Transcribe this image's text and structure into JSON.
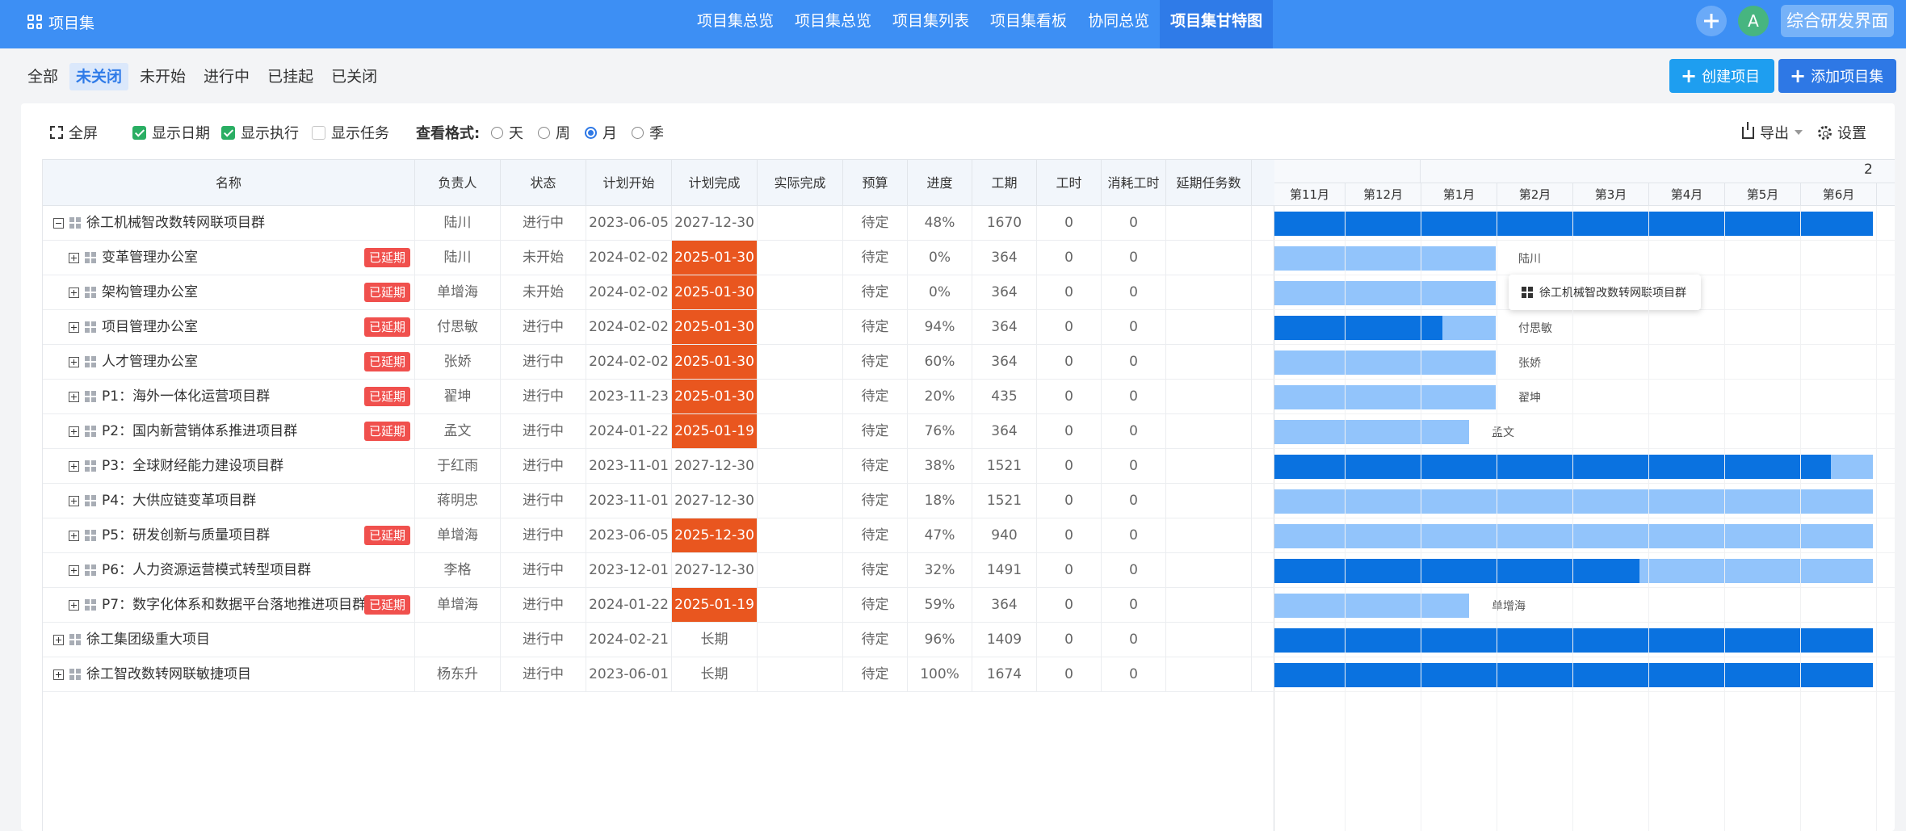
{
  "topbar": {
    "brand": "项目集",
    "nav": [
      "项目集总览",
      "项目集总览",
      "项目集列表",
      "项目集看板",
      "协同总览",
      "项目集甘特图"
    ],
    "active_index": 5,
    "avatar": "A",
    "switch_label": "综合研发界面"
  },
  "filters": {
    "items": [
      "全部",
      "未关闭",
      "未开始",
      "进行中",
      "已挂起",
      "已关闭"
    ],
    "active_index": 1
  },
  "actions": {
    "create": "创建项目",
    "add_set": "添加项目集"
  },
  "toolbar": {
    "fullscreen": "全屏",
    "show_date": "显示日期",
    "show_exec": "显示执行",
    "show_task": "显示任务",
    "view_format": "查看格式:",
    "day": "天",
    "week": "周",
    "month": "月",
    "season": "季",
    "selected_view": "月",
    "export": "导出",
    "settings": "设置"
  },
  "table": {
    "columns": [
      "名称",
      "负责人",
      "状态",
      "计划开始",
      "计划完成",
      "实际完成",
      "预算",
      "进度",
      "工期",
      "工时",
      "消耗工时",
      "延期任务数"
    ],
    "overdue_label": "已延期",
    "rows": [
      {
        "name": "徐工机械智改数转网联项目群",
        "level": 0,
        "expanded": true,
        "owner": "陆川",
        "status": "进行中",
        "start": "2023-06-05",
        "end": "2027-12-30",
        "overdue": false,
        "actual": "",
        "budget": "待定",
        "progress": "48%",
        "duration": "1670",
        "hours": "0",
        "consumed": "0",
        "delayed": ""
      },
      {
        "name": "变革管理办公室",
        "level": 1,
        "expanded": false,
        "owner": "陆川",
        "status": "未开始",
        "start": "2024-02-02",
        "end": "2025-01-30",
        "overdue": true,
        "actual": "",
        "budget": "待定",
        "progress": "0%",
        "duration": "364",
        "hours": "0",
        "consumed": "0",
        "delayed": ""
      },
      {
        "name": "架构管理办公室",
        "level": 1,
        "expanded": false,
        "owner": "单增海",
        "status": "未开始",
        "start": "2024-02-02",
        "end": "2025-01-30",
        "overdue": true,
        "actual": "",
        "budget": "待定",
        "progress": "0%",
        "duration": "364",
        "hours": "0",
        "consumed": "0",
        "delayed": ""
      },
      {
        "name": "项目管理办公室",
        "level": 1,
        "expanded": false,
        "owner": "付思敏",
        "status": "进行中",
        "start": "2024-02-02",
        "end": "2025-01-30",
        "overdue": true,
        "actual": "",
        "budget": "待定",
        "progress": "94%",
        "duration": "364",
        "hours": "0",
        "consumed": "0",
        "delayed": ""
      },
      {
        "name": "人才管理办公室",
        "level": 1,
        "expanded": false,
        "owner": "张娇",
        "status": "进行中",
        "start": "2024-02-02",
        "end": "2025-01-30",
        "overdue": true,
        "actual": "",
        "budget": "待定",
        "progress": "60%",
        "duration": "364",
        "hours": "0",
        "consumed": "0",
        "delayed": ""
      },
      {
        "name": "P1：海外一体化运营项目群",
        "level": 1,
        "expanded": false,
        "owner": "翟坤",
        "status": "进行中",
        "start": "2023-11-23",
        "end": "2025-01-30",
        "overdue": true,
        "actual": "",
        "budget": "待定",
        "progress": "20%",
        "duration": "435",
        "hours": "0",
        "consumed": "0",
        "delayed": ""
      },
      {
        "name": "P2：国内新营销体系推进项目群",
        "level": 1,
        "expanded": false,
        "owner": "孟文",
        "status": "进行中",
        "start": "2024-01-22",
        "end": "2025-01-19",
        "overdue": true,
        "actual": "",
        "budget": "待定",
        "progress": "76%",
        "duration": "364",
        "hours": "0",
        "consumed": "0",
        "delayed": ""
      },
      {
        "name": "P3：全球财经能力建设项目群",
        "level": 1,
        "expanded": false,
        "owner": "于红雨",
        "status": "进行中",
        "start": "2023-11-01",
        "end": "2027-12-30",
        "overdue": false,
        "actual": "",
        "budget": "待定",
        "progress": "38%",
        "duration": "1521",
        "hours": "0",
        "consumed": "0",
        "delayed": ""
      },
      {
        "name": "P4：大供应链变革项目群",
        "level": 1,
        "expanded": false,
        "owner": "蒋明忠",
        "status": "进行中",
        "start": "2023-11-01",
        "end": "2027-12-30",
        "overdue": false,
        "actual": "",
        "budget": "待定",
        "progress": "18%",
        "duration": "1521",
        "hours": "0",
        "consumed": "0",
        "delayed": ""
      },
      {
        "name": "P5：研发创新与质量项目群",
        "level": 1,
        "expanded": false,
        "owner": "单增海",
        "status": "进行中",
        "start": "2023-06-05",
        "end": "2025-12-30",
        "overdue": true,
        "actual": "",
        "budget": "待定",
        "progress": "47%",
        "duration": "940",
        "hours": "0",
        "consumed": "0",
        "delayed": ""
      },
      {
        "name": "P6：人力资源运营模式转型项目群",
        "level": 1,
        "expanded": false,
        "owner": "李格",
        "status": "进行中",
        "start": "2023-12-01",
        "end": "2027-12-30",
        "overdue": false,
        "actual": "",
        "budget": "待定",
        "progress": "32%",
        "duration": "1491",
        "hours": "0",
        "consumed": "0",
        "delayed": ""
      },
      {
        "name": "P7：数字化体系和数据平台落地推进项目群",
        "level": 1,
        "expanded": false,
        "owner": "单增海",
        "status": "进行中",
        "start": "2024-01-22",
        "end": "2025-01-19",
        "overdue": true,
        "actual": "",
        "budget": "待定",
        "progress": "59%",
        "duration": "364",
        "hours": "0",
        "consumed": "0",
        "delayed": ""
      },
      {
        "name": "徐工集团级重大项目",
        "level": 0,
        "expanded": false,
        "owner": "",
        "status": "进行中",
        "start": "2024-02-21",
        "end": "长期",
        "overdue": false,
        "actual": "",
        "budget": "待定",
        "progress": "96%",
        "duration": "1409",
        "hours": "0",
        "consumed": "0",
        "delayed": ""
      },
      {
        "name": "徐工智改数转网联敏捷项目",
        "level": 0,
        "expanded": false,
        "owner": "杨东升",
        "status": "进行中",
        "start": "2023-06-01",
        "end": "长期",
        "overdue": false,
        "actual": "",
        "budget": "待定",
        "progress": "100%",
        "duration": "1674",
        "hours": "0",
        "consumed": "0",
        "delayed": ""
      }
    ]
  },
  "gantt": {
    "year_label": "2",
    "months": [
      "第11月",
      "第12月",
      "第1月",
      "第2月",
      "第3月",
      "第4月",
      "第5月",
      "第6月"
    ],
    "bars": [
      {
        "label": "",
        "progress": 1.0,
        "extent": 1.0
      },
      {
        "label": "陆川",
        "progress": 0.0,
        "extent": 0.37
      },
      {
        "label": "单增海",
        "progress": 0.0,
        "extent": 0.37
      },
      {
        "label": "付思敏",
        "progress": 0.76,
        "extent": 0.37
      },
      {
        "label": "张娇",
        "progress": 0.0,
        "extent": 0.37
      },
      {
        "label": "翟坤",
        "progress": 0.0,
        "extent": 0.37
      },
      {
        "label": "孟文",
        "progress": 0.0,
        "extent": 0.325
      },
      {
        "label": "",
        "progress": 0.93,
        "extent": 1.0
      },
      {
        "label": "",
        "progress": 0.0,
        "extent": 1.0
      },
      {
        "label": "",
        "progress": 0.0,
        "extent": 1.0
      },
      {
        "label": "",
        "progress": 0.61,
        "extent": 1.0
      },
      {
        "label": "单增海",
        "progress": 0.0,
        "extent": 0.325
      },
      {
        "label": "",
        "progress": 1.0,
        "extent": 1.0
      },
      {
        "label": "",
        "progress": 1.0,
        "extent": 1.0
      }
    ],
    "tooltip": "徐工机械智改数转网联项目群"
  },
  "colors": {
    "primary": "#3d8ff4",
    "bar_dark": "#0a72e0",
    "bar_light": "#92c4fb",
    "overdue": "#e9561f",
    "badge": "#f0504d"
  }
}
